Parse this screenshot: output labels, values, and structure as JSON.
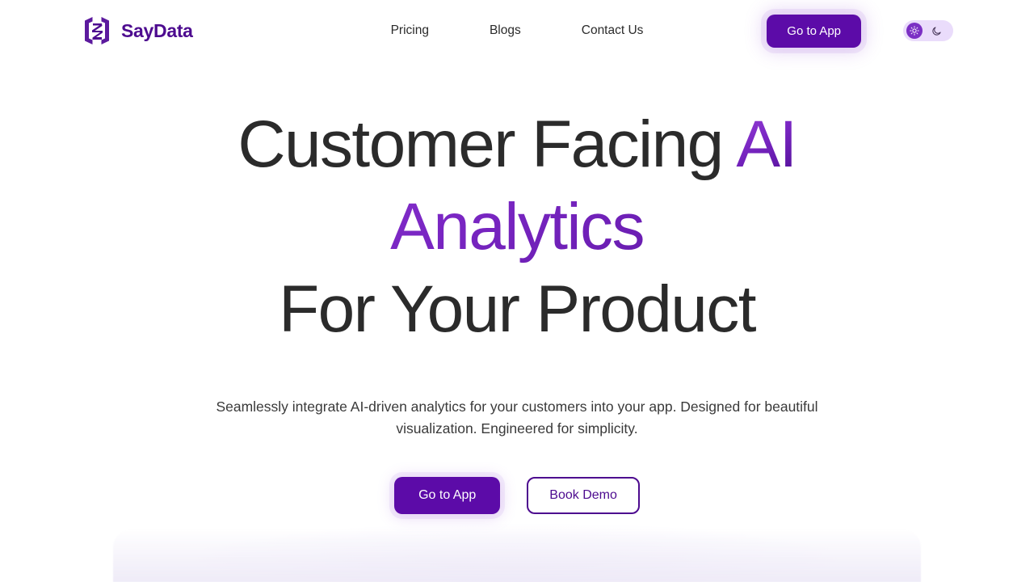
{
  "brand": {
    "name": "SayData",
    "logo_icon": "saydata-bracket-s-logo",
    "color": "#4d0b8f"
  },
  "nav": {
    "items": [
      {
        "label": "Pricing"
      },
      {
        "label": "Blogs"
      },
      {
        "label": "Contact Us"
      }
    ]
  },
  "header": {
    "cta_label": "Go to App",
    "theme_toggle": {
      "light_icon": "sun-icon",
      "dark_icon": "moon-icon",
      "active": "light"
    }
  },
  "hero": {
    "headline": {
      "line1_plain": "Customer Facing ",
      "line1_accent": "AI",
      "line2_accent": "Analytics",
      "line3_plain": "For Your Product"
    },
    "subtitle": "Seamlessly integrate AI-driven analytics for your customers into your app. Designed for beautiful visualization. Engineered for simplicity.",
    "primary_cta": "Go to App",
    "secondary_cta": "Book Demo"
  },
  "theme": {
    "accent": "#5c0ba8",
    "accent_light": "#9a46d8",
    "accent_dark": "#4d0b8f",
    "text": "#2b2b2b",
    "background": "#ffffff",
    "toggle_bg": "#eadcfb"
  }
}
